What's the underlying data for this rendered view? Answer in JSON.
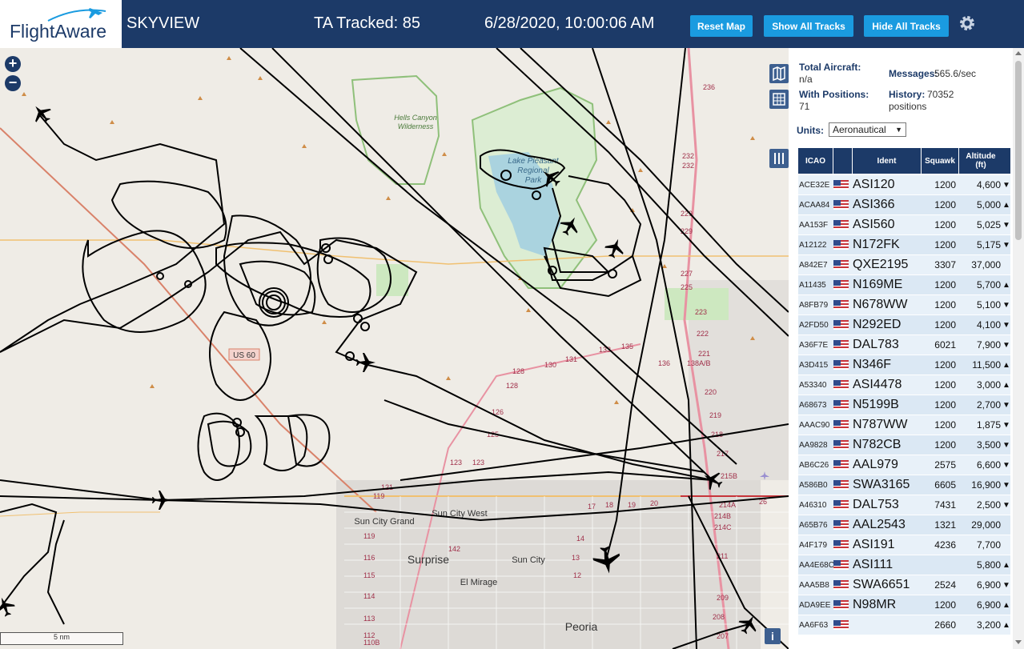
{
  "header": {
    "logo_text": "FlightAware",
    "app_title": "SKYVIEW",
    "ta_tracked": "TA Tracked: 85",
    "timestamp": "6/28/2020, 10:00:06 AM",
    "buttons": {
      "reset": "Reset Map",
      "show": "Show All Tracks",
      "hide": "Hide All Tracks"
    },
    "settings_icon": "gear-icon"
  },
  "map": {
    "zoom_in": "+",
    "zoom_out": "−",
    "scale": "5 nm",
    "info": "i",
    "labels": {
      "hells_canyon_1": "Hells Canyon",
      "hells_canyon_2": "Wilderness",
      "lake_1": "Lake Pleasant",
      "lake_2": "Regional",
      "lake_3": "Park",
      "us60": "US 60",
      "sun_city_west": "Sun City West",
      "sun_city_grand": "Sun City Grand",
      "surprise": "Surprise",
      "sun_city": "Sun City",
      "el_mirage": "El Mirage",
      "peoria": "Peoria"
    },
    "road_numbers": [
      "236",
      "232",
      "232",
      "229",
      "229",
      "227",
      "225",
      "223",
      "222",
      "221",
      "220",
      "219",
      "218",
      "217",
      "215B",
      "214A",
      "214B",
      "214C",
      "211",
      "209",
      "208",
      "207",
      "131",
      "133",
      "135",
      "136",
      "138A/B",
      "130",
      "128",
      "128",
      "126",
      "125",
      "123",
      "123",
      "121",
      "119",
      "119",
      "116",
      "115",
      "114",
      "113",
      "112",
      "110B",
      "142",
      "17",
      "18",
      "19",
      "20",
      "14",
      "13",
      "12",
      "26"
    ],
    "colors": {
      "land": "#efece6",
      "water": "#aad3df",
      "park": "#cde8c0",
      "park_border": "#8fc07a",
      "track": "#000000",
      "highway": "#e892a2",
      "road_orange": "#f0c070",
      "primary_road": "#d9826a"
    }
  },
  "stats": {
    "total_label": "Total Aircraft:",
    "total_value": "n/a",
    "messages_label": "Messages:",
    "messages_value": "565.6/sec",
    "positions_label": "With Positions:",
    "positions_value": "71",
    "history_label": "History:",
    "history_value": "70352",
    "history_unit": "positions",
    "units_label": "Units:",
    "units_value": "Aeronautical"
  },
  "table": {
    "headers": {
      "icao": "ICAO",
      "ident": "Ident",
      "squawk": "Squawk",
      "alt1": "Altitude",
      "alt2": "(ft)"
    },
    "rows": [
      {
        "icao": "ACE32E",
        "ident": "ASI120",
        "squawk": "1200",
        "alt": "4,600",
        "trend": "▼"
      },
      {
        "icao": "ACAA84",
        "ident": "ASI366",
        "squawk": "1200",
        "alt": "5,000",
        "trend": "▲"
      },
      {
        "icao": "AA153F",
        "ident": "ASI560",
        "squawk": "1200",
        "alt": "5,025",
        "trend": "▼"
      },
      {
        "icao": "A12122",
        "ident": "N172FK",
        "squawk": "1200",
        "alt": "5,175",
        "trend": "▼"
      },
      {
        "icao": "A842E7",
        "ident": "QXE2195",
        "squawk": "3307",
        "alt": "37,000",
        "trend": ""
      },
      {
        "icao": "A11435",
        "ident": "N169ME",
        "squawk": "1200",
        "alt": "5,700",
        "trend": "▲"
      },
      {
        "icao": "A8FB79",
        "ident": "N678WW",
        "squawk": "1200",
        "alt": "5,100",
        "trend": "▼"
      },
      {
        "icao": "A2FD50",
        "ident": "N292ED",
        "squawk": "1200",
        "alt": "4,100",
        "trend": "▼"
      },
      {
        "icao": "A36F7E",
        "ident": "DAL783",
        "squawk": "6021",
        "alt": "7,900",
        "trend": "▼"
      },
      {
        "icao": "A3D415",
        "ident": "N346F",
        "squawk": "1200",
        "alt": "11,500",
        "trend": "▲"
      },
      {
        "icao": "A53340",
        "ident": "ASI4478",
        "squawk": "1200",
        "alt": "3,000",
        "trend": "▲"
      },
      {
        "icao": "A68673",
        "ident": "N5199B",
        "squawk": "1200",
        "alt": "2,700",
        "trend": "▼"
      },
      {
        "icao": "AAAC90",
        "ident": "N787WW",
        "squawk": "1200",
        "alt": "1,875",
        "trend": "▼"
      },
      {
        "icao": "AA9828",
        "ident": "N782CB",
        "squawk": "1200",
        "alt": "3,500",
        "trend": "▼"
      },
      {
        "icao": "AB6C26",
        "ident": "AAL979",
        "squawk": "2575",
        "alt": "6,600",
        "trend": "▼"
      },
      {
        "icao": "A586B0",
        "ident": "SWA3165",
        "squawk": "6605",
        "alt": "16,900",
        "trend": "▼"
      },
      {
        "icao": "A46310",
        "ident": "DAL753",
        "squawk": "7431",
        "alt": "2,500",
        "trend": "▼"
      },
      {
        "icao": "A65B76",
        "ident": "AAL2543",
        "squawk": "1321",
        "alt": "29,000",
        "trend": ""
      },
      {
        "icao": "A4F179",
        "ident": "ASI191",
        "squawk": "4236",
        "alt": "7,700",
        "trend": ""
      },
      {
        "icao": "AA4E68C",
        "ident": "ASI111",
        "squawk": "",
        "alt": "5,800",
        "trend": "▲"
      },
      {
        "icao": "AAA5B8",
        "ident": "SWA6651",
        "squawk": "2524",
        "alt": "6,900",
        "trend": "▼"
      },
      {
        "icao": "ADA9EE",
        "ident": "N98MR",
        "squawk": "1200",
        "alt": "6,900",
        "trend": "▲"
      },
      {
        "icao": "AA6F63",
        "ident": "",
        "squawk": "2660",
        "alt": "3,200",
        "trend": "▲"
      }
    ]
  }
}
